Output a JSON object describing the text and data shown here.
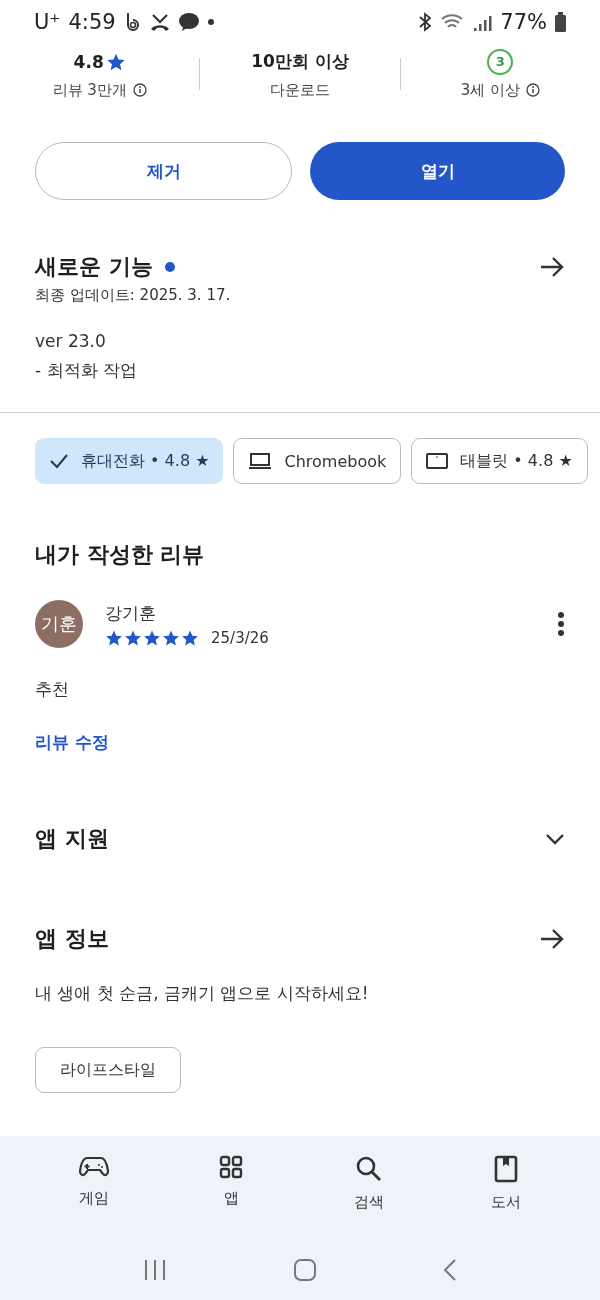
{
  "status_bar": {
    "carrier": "U⁺",
    "time": "4:59",
    "battery": "77%"
  },
  "stats": [
    {
      "kind": "rating",
      "value": "4.8",
      "label": "리뷰 3만개",
      "info": true
    },
    {
      "kind": "text",
      "value": "10만회 이상",
      "label": "다운로드",
      "info": false
    },
    {
      "kind": "age",
      "value": "3",
      "label": "3세 이상",
      "info": true
    }
  ],
  "actions": [
    {
      "label": "제거",
      "kind": "outline"
    },
    {
      "label": "열기",
      "kind": "filled"
    }
  ],
  "whats_new": {
    "title": "새로운 기능",
    "updated": "최종 업데이트: 2025. 3. 17.",
    "version": "ver 23.0",
    "notes": "- 최적화 작업"
  },
  "devices": [
    {
      "label": "휴대전화 • 4.8 ★",
      "selected": true
    },
    {
      "label": "Chromebook",
      "kind": "laptop",
      "selected": false
    },
    {
      "label": "태블릿 • 4.8 ★",
      "kind": "tablet",
      "selected": false
    }
  ],
  "my_review": {
    "heading": "내가 작성한 리뷰",
    "avatar": "기훈",
    "name": "강기훈",
    "stars": 5,
    "date": "25/3/26",
    "text": "추천",
    "edit": "리뷰 수정"
  },
  "sections": [
    {
      "title": "앱 지원",
      "kind": "expand"
    },
    {
      "title": "앱 정보",
      "kind": "link"
    }
  ],
  "description": "내 생애 첫 순금, 금캐기 앱으로 시작하세요!",
  "tag": "라이프스타일",
  "bottom_nav": [
    {
      "label": "게임",
      "kind": "games"
    },
    {
      "label": "앱",
      "kind": "apps"
    },
    {
      "label": "검색",
      "kind": "search"
    },
    {
      "label": "도서",
      "kind": "books"
    }
  ]
}
